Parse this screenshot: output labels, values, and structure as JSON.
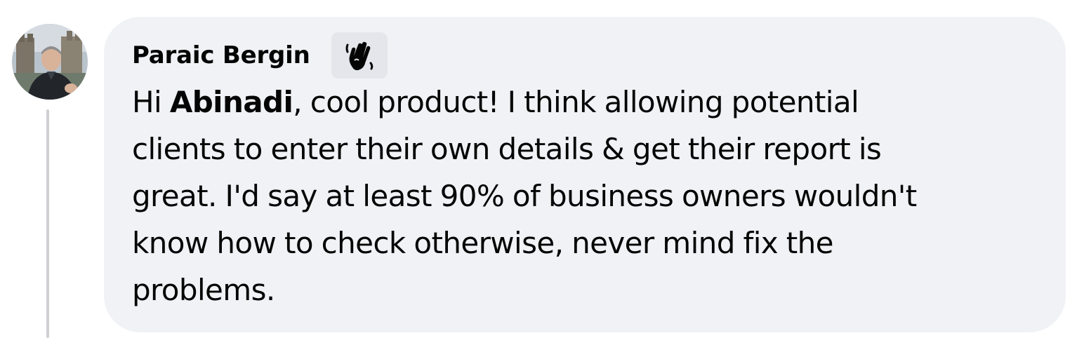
{
  "comment": {
    "author": "Paraic Bergin",
    "badge_icon": "waving-hand-icon",
    "text": {
      "line1_prefix": "Hi ",
      "mention": "Abinadi",
      "line1_suffix": ", cool product! I think allowing potential",
      "line2": "clients to enter their own details & get their report is",
      "line3": "great. I'd say at least 90% of business owners wouldn't",
      "line4": "know how to check otherwise, never mind fix the",
      "line5": "problems."
    }
  },
  "colors": {
    "bubble_background": "#f0f2f5",
    "badge_background": "#e4e6eb",
    "thread_line": "#ced0d4",
    "text": "#050505"
  }
}
